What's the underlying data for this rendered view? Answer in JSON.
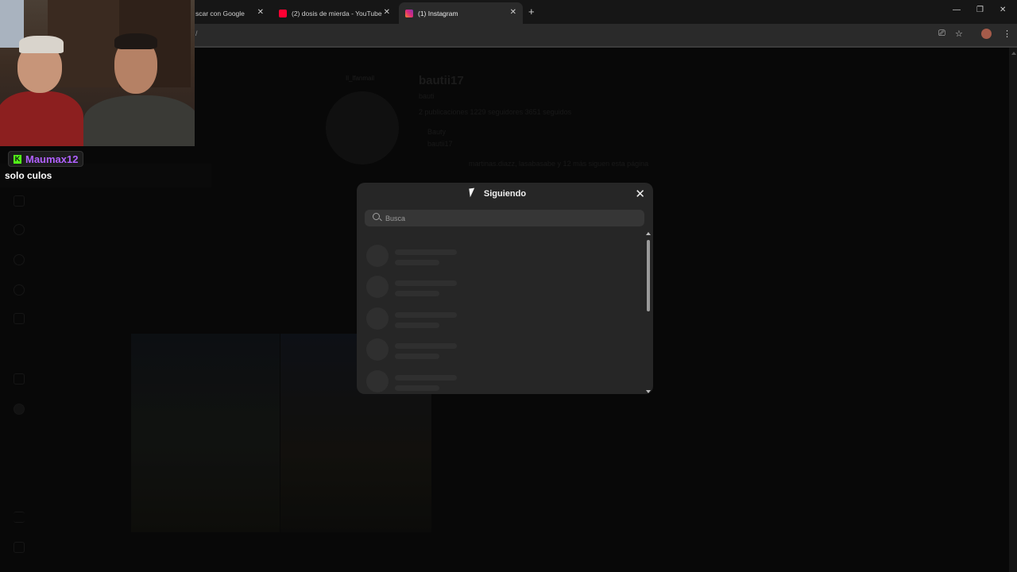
{
  "browser": {
    "tabs": [
      {
        "label": "scar con Google",
        "active": false
      },
      {
        "label": "(2) dosis de mierda - YouTube",
        "active": false
      },
      {
        "label": "(1) Instagram",
        "active": true
      }
    ],
    "new_tab_icon": "plus-icon",
    "window_controls": [
      "minimize-icon",
      "restore-icon",
      "close-icon"
    ],
    "address_fragment": "/"
  },
  "profile_bg": {
    "username": "bautii17",
    "note": "Il_lfanmail",
    "subtitle": "bauti",
    "stats": "2 publicaciones   1229 seguidores   3651 seguidos",
    "line1": "Bauty",
    "line2": "bautii17",
    "followed_by": "martinas.diazz, lasabasabe y 12 más siguen esta página"
  },
  "modal": {
    "title": "Siguiendo",
    "close_icon": "close-icon",
    "search_placeholder": "Busca",
    "skeleton_rows": 5
  },
  "stream_overlay": {
    "chat_user": "Maumax12",
    "chat_message": "solo culos",
    "platform_icon": "kick-icon",
    "accent_color": "#b060ff"
  }
}
